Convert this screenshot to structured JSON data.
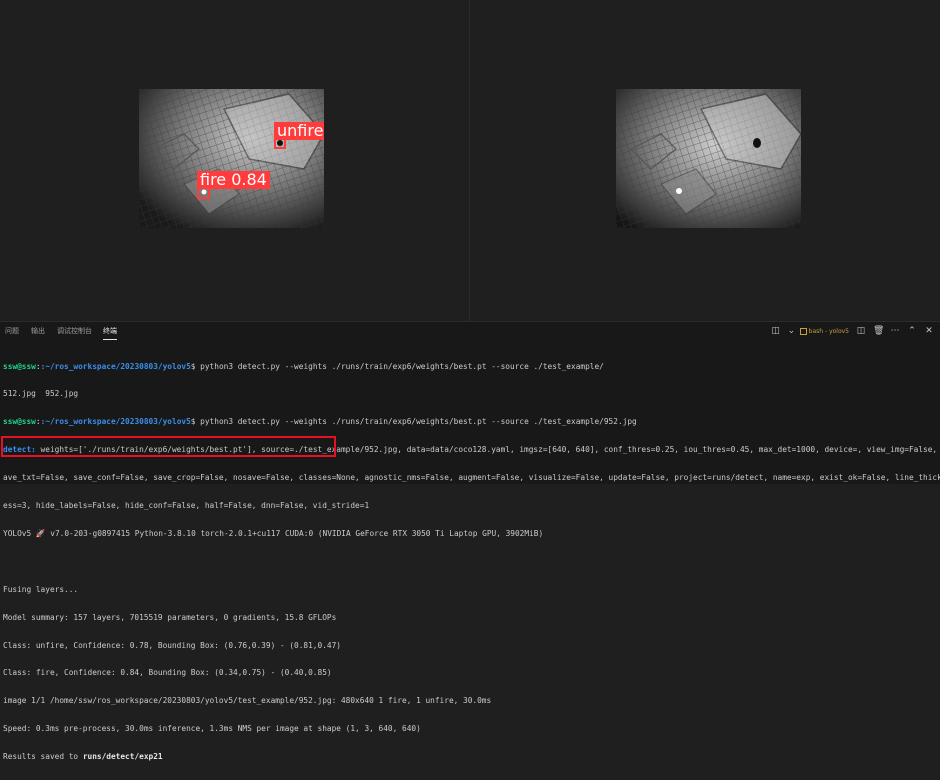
{
  "left_image": {
    "detections": [
      {
        "label": "unfire"
      },
      {
        "label": "fire  0.84"
      }
    ]
  },
  "panel": {
    "tabs": [
      "问题",
      "输出",
      "调试控制台",
      "终端"
    ],
    "active_tab": "终端",
    "terminal_name": "bash - yolov5"
  },
  "terminal": {
    "prompt_user": "ssw@ssw",
    "prompt_path": ":~/ros_workspace/20230803/yolov5",
    "cmd1": "$ python3 detect.py --weights ./runs/train/exp6/weights/best.pt --source ./test_example/",
    "out1": "512.jpg  952.jpg",
    "cmd2": "$ python3 detect.py --weights ./runs/train/exp6/weights/best.pt --source ./test_example/952.jpg",
    "detect_label": "detect:",
    "detect_l1": " weights=['./runs/train/exp6/weights/best.pt'], source=./test_example/952.jpg, data=data/coco128.yaml, imgsz=[640, 640], conf_thres=0.25, iou_thres=0.45, max_det=1000, device=, view_img=False, s",
    "detect_l2": "ave_txt=False, save_conf=False, save_crop=False, nosave=False, classes=None, agnostic_nms=False, augment=False, visualize=False, update=False, project=runs/detect, name=exp, exist_ok=False, line_thickn",
    "detect_l3": "ess=3, hide_labels=False, hide_conf=False, half=False, dnn=False, vid_stride=1",
    "yolo_line": "YOLOv5 🚀 v7.0-203-g0897415 Python-3.8.10 torch-2.0.1+cu117 CUDA:0 (NVIDIA GeForce RTX 3050 Ti Laptop GPU, 3902MiB)",
    "blank": "",
    "fusing": "Fusing layers...",
    "summary": "Model summary: 157 layers, 7015519 parameters, 0 gradients, 15.8 GFLOPs",
    "class1": "Class: unfire, Confidence: 0.78, Bounding Box: (0.76,0.39) - (0.81,0.47)",
    "class2": "Class: fire, Confidence: 0.84, Bounding Box: (0.34,0.75) - (0.40,0.85)",
    "image_line": "image 1/1 /home/ssw/ros_workspace/20230803/yolov5/test_example/952.jpg: 480x640 1 fire, 1 unfire, 30.0ms",
    "speed_line": "Speed: 0.3ms pre-process, 30.0ms inference, 1.3ms NMS per image at shape (1, 3, 640, 640)",
    "saved_prefix": "Results saved to ",
    "saved_path": "runs/detect/exp21"
  }
}
